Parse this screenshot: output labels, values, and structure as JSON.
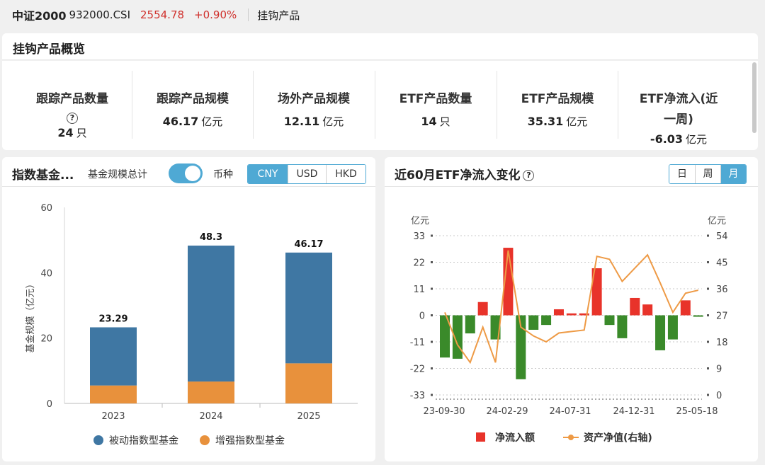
{
  "topbar": {
    "name": "中证2000",
    "code": "932000.CSI",
    "price": "2554.78",
    "change_pct": "+0.90%",
    "tag": "挂钩产品"
  },
  "overview": {
    "title": "挂钩产品概览",
    "stats": [
      {
        "label": "跟踪产品数量",
        "help": "?",
        "value": "24",
        "unit": "只"
      },
      {
        "label": "跟踪产品规模",
        "value": "46.17",
        "unit": "亿元"
      },
      {
        "label": "场外产品规模",
        "value": "12.11",
        "unit": "亿元"
      },
      {
        "label": "ETF产品数量",
        "value": "14",
        "unit": "只"
      },
      {
        "label": "ETF产品规模",
        "value": "35.31",
        "unit": "亿元"
      },
      {
        "label_line1": "ETF净流入(近",
        "label_line2": "一周)",
        "value": "-6.03",
        "unit": "亿元"
      }
    ]
  },
  "fund_card": {
    "title": "指数基金...",
    "total_label": "基金规模总计",
    "toggle_on": true,
    "currency_label": "币种",
    "currencies": [
      "CNY",
      "USD",
      "HKD"
    ],
    "active_currency": "CNY"
  },
  "etf_card": {
    "title": "近60月ETF净流入变化",
    "help": "?",
    "periods": [
      "日",
      "周",
      "月"
    ],
    "active_period": "月"
  },
  "colors": {
    "passive": "#3f77a3",
    "enhanced": "#e8913c",
    "inflow_pos": "#e8332a",
    "inflow_neg": "#3a8a2a",
    "nav_line": "#ee9a45",
    "accent": "#4fa9d4",
    "price_up": "#d0312d"
  },
  "chart_data": [
    {
      "type": "bar",
      "stacked": true,
      "categories": [
        "2023",
        "2024",
        "2025"
      ],
      "series": [
        {
          "name": "被动指数型基金",
          "values": [
            17.8,
            41.6,
            33.9
          ]
        },
        {
          "name": "增强指数型基金",
          "values": [
            5.49,
            6.7,
            12.27
          ]
        }
      ],
      "totals": [
        "23.29",
        "48.3",
        "46.17"
      ],
      "ylabel": "基金规模（亿元）",
      "ylim": [
        0,
        60
      ],
      "yticks": [
        "0",
        "20",
        "40",
        "60"
      ],
      "legend_position": "bottom",
      "grid": false
    },
    {
      "type": "bar+line",
      "x_ticks": [
        "23-09-30",
        "24-02-29",
        "24-07-31",
        "24-12-31",
        "25-05-18"
      ],
      "left_axis_unit": "亿元",
      "right_axis_unit": "亿元",
      "left_ylim": [
        -33,
        33
      ],
      "left_yticks": [
        "33",
        "22",
        "11",
        "0",
        "-11",
        "-22",
        "-33"
      ],
      "right_ylim": [
        0,
        54
      ],
      "right_yticks": [
        "54",
        "45",
        "36",
        "27",
        "18",
        "9",
        "0"
      ],
      "series": [
        {
          "name": "净流入额",
          "type": "bar",
          "values": [
            -17.5,
            -18,
            -7.5,
            5.5,
            -10,
            28,
            -26.5,
            -6,
            -4,
            2.5,
            0.8,
            0.8,
            19.5,
            -4,
            -9.5,
            7.2,
            4.5,
            -14.5,
            -10,
            6.2,
            -0.6
          ]
        },
        {
          "name": "资产净值(右轴)",
          "type": "line",
          "values": [
            28,
            17,
            11,
            23,
            11,
            49,
            23,
            20,
            18,
            21,
            21.5,
            22,
            47,
            46,
            38.5,
            43,
            47.5,
            38,
            28,
            34.5,
            35.5
          ]
        }
      ],
      "grid": true,
      "legend_position": "bottom"
    }
  ]
}
